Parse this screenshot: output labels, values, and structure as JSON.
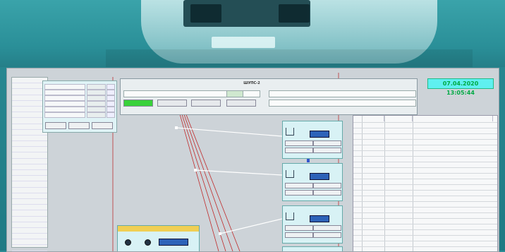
{
  "colors": {
    "hero_teal": "#2a8f98",
    "screen_bg": "#cdd3d8",
    "green_button": "#39d13a",
    "clock_bg": "#5ff0f0",
    "lcd_blue": "#2d62b8",
    "local_title": "#f0cf54",
    "line_red": "#c02a2a"
  },
  "window": {
    "title": ""
  },
  "header": {
    "title": "ШУПС-2",
    "left_field": "",
    "right_field_1": "",
    "right_field_2": "",
    "buttons": [
      "",
      "",
      "",
      ""
    ]
  },
  "clock": {
    "text": "07.04.2020 13:05:44"
  },
  "left_panel": {
    "title": "",
    "items": [
      "",
      "",
      "",
      "",
      "",
      "",
      "",
      "",
      "",
      "",
      "",
      "",
      "",
      "",
      "",
      "",
      "",
      "",
      "",
      "",
      "",
      "",
      "",
      "",
      "",
      "",
      "",
      "",
      "",
      "",
      "",
      ""
    ]
  },
  "params": {
    "rows": [
      {
        "label": "",
        "value": ""
      },
      {
        "label": "",
        "value": ""
      },
      {
        "label": "",
        "value": ""
      },
      {
        "label": "",
        "value": ""
      },
      {
        "label": "",
        "value": ""
      },
      {
        "label": "",
        "value": ""
      }
    ],
    "buttons": [
      "",
      "",
      ""
    ]
  },
  "stations": [
    {
      "name": "",
      "code": "",
      "lcd": "",
      "btn1": "",
      "btn2": "",
      "btn3": "",
      "btn4": ""
    },
    {
      "name": "",
      "code": "",
      "lcd": "",
      "btn1": "",
      "btn2": "",
      "btn3": "",
      "btn4": ""
    },
    {
      "name": "",
      "code": "",
      "lcd": "",
      "btn1": "",
      "btn2": "",
      "btn3": "",
      "btn4": ""
    }
  ],
  "local_control": {
    "title": "",
    "labels": [
      "",
      "",
      ""
    ],
    "lcd": ""
  },
  "table": {
    "headers": [
      "",
      "",
      ""
    ]
  },
  "icons": [
    "wave-icon",
    "indicator-dot-icon"
  ]
}
